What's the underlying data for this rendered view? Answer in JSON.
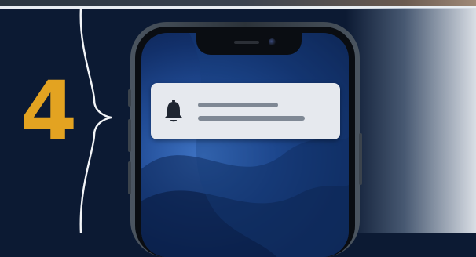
{
  "step": {
    "number": "4",
    "number_color": "#e3a321"
  },
  "notification": {
    "icon": "bell-icon",
    "text_lines": 2,
    "background": "#e6e9ee"
  },
  "phone": {
    "wallpaper": "blue-wave",
    "frame_color": "#3b434c"
  },
  "colors": {
    "background": "#0c1a33",
    "bracket": "#f2f4f7",
    "accent": "#e3a321"
  }
}
